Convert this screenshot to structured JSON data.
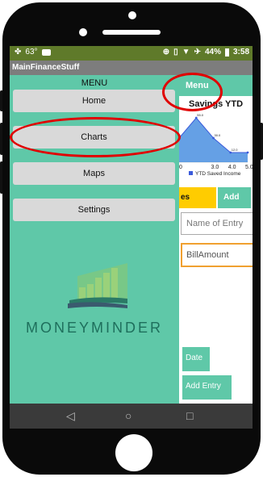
{
  "status_bar": {
    "left_temp": "63°",
    "battery": "44%",
    "time": "3:58"
  },
  "app_bar": {
    "title": "MainFinanceStuff"
  },
  "drawer": {
    "title": "MENU",
    "items": [
      {
        "label": "Home"
      },
      {
        "label": "Charts"
      },
      {
        "label": "Maps"
      },
      {
        "label": "Settings"
      }
    ],
    "brand": "MONEYMINDER"
  },
  "right_panel": {
    "menu_button": "Menu",
    "chart_title": "Savings YTD",
    "tab_partial": "es",
    "tab_add": "Add",
    "name_placeholder": "Name of Entry",
    "amount_value": "BillAmount",
    "date_button": "Date",
    "add_entry_button": "Add Entry"
  },
  "chart_data": {
    "type": "area",
    "title": "Savings YTD",
    "x_tick_labels": [
      "0",
      "3.0",
      "4.0",
      "5.0"
    ],
    "series": [
      {
        "name": "YTD Saved Income",
        "points": [
          {
            "x": 1.0,
            "y": 30.0
          },
          {
            "x": 2.0,
            "y": 55.0
          },
          {
            "x": 3.0,
            "y": 30.0
          },
          {
            "x": 4.0,
            "y": 12.0
          },
          {
            "x": 5.0,
            "y": 12.0
          }
        ],
        "data_labels": [
          "",
          "55.0",
          "30.0",
          "12.0",
          ""
        ]
      }
    ],
    "xlim": [
      1.0,
      5.0
    ],
    "ylim": [
      0,
      60
    ],
    "legend": "bottom",
    "series_color": "#3b5bdb"
  },
  "nav_bar": {
    "back_icon": "◁",
    "home_icon": "○",
    "recent_icon": "□"
  },
  "colors": {
    "drawer": "#5fc8a8",
    "status_bar": "#5f7a2a",
    "annotation": "#e00000",
    "tab_highlight": "#ffcc00"
  }
}
